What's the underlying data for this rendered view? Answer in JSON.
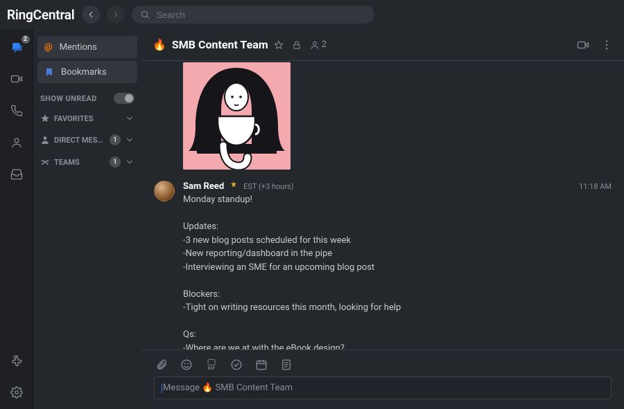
{
  "app": {
    "brand": "RingCentral",
    "search_placeholder": "Search"
  },
  "rail": {
    "message_badge": "2"
  },
  "sidebar": {
    "mentions": "Mentions",
    "bookmarks": "Bookmarks",
    "show_unread": "SHOW UNREAD",
    "favorites": "FAVORITES",
    "direct_messages": "DIRECT MESSAG...",
    "dm_count": "1",
    "teams": "TEAMS",
    "teams_count": "1"
  },
  "channel": {
    "emoji": "🔥",
    "name": "SMB Content Team",
    "members": "2"
  },
  "messages": {
    "m1": {
      "author": "Sam Reed",
      "tz": "EST (+3 hours)",
      "time": "11:18 AM",
      "body": "Monday standup!\n\nUpdates:\n-3 new blog posts scheduled for this week\n-New reporting/dashboard in the pipe\n-Interviewing an SME for an upcoming blog post\n\nBlockers:\n-Tight on writing resources this month, looking for help\n\nQs:\n-Where are we at with the eBook design?"
    }
  },
  "composer": {
    "placeholder": "Message 🔥 SMB Content Team",
    "gif_label": "GIF"
  }
}
